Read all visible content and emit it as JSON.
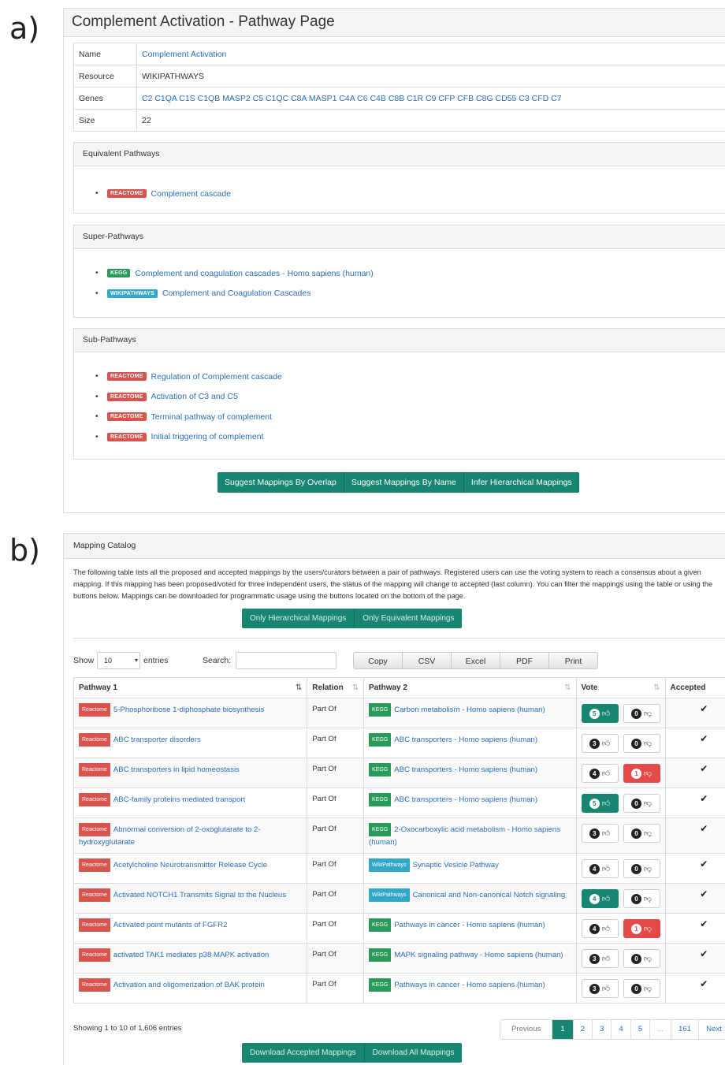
{
  "labels": {
    "a": "a)",
    "b": "b)"
  },
  "colors": {
    "accent": "#17856f",
    "reactome": "#d9534f",
    "kegg": "#2a9a5a",
    "wikipathways": "#32a8c8",
    "link": "#2a6ebb"
  },
  "pathway_page": {
    "title": "Complement Activation - Pathway Page",
    "info": [
      {
        "key": "Name",
        "value": "Complement Activation",
        "link": true
      },
      {
        "key": "Resource",
        "value": "WIKIPATHWAYS",
        "link": false
      },
      {
        "key": "Genes",
        "value": "C2 C1QA C1S C1QB MASP2 C5 C1QC C8A MASP1 C4A C6 C4B C8B C1R C9 CFP CFB C8G CD55 C3 CFD C7",
        "link": true
      },
      {
        "key": "Size",
        "value": "22",
        "link": false
      }
    ],
    "equivalent": {
      "heading": "Equivalent Pathways",
      "items": [
        {
          "badge": "REACTOME",
          "label": "Complement cascade"
        }
      ]
    },
    "super": {
      "heading": "Super-Pathways",
      "items": [
        {
          "badge": "KEGG",
          "label": "Complement and coagulation cascades - Homo sapiens (human)"
        },
        {
          "badge": "WIKIPATHWAYS",
          "label": "Complement and Coagulation Cascades"
        }
      ]
    },
    "sub": {
      "heading": "Sub-Pathways",
      "items": [
        {
          "badge": "REACTOME",
          "label": "Regulation of Complement cascade"
        },
        {
          "badge": "REACTOME",
          "label": "Activation of C3 and C5"
        },
        {
          "badge": "REACTOME",
          "label": "Terminal pathway of complement"
        },
        {
          "badge": "REACTOME",
          "label": "Initial triggering of complement"
        }
      ]
    },
    "buttons": [
      "Suggest Mappings By Overlap",
      "Suggest Mappings By Name",
      "Infer Hierarchical Mappings"
    ]
  },
  "mapping_catalog": {
    "title": "Mapping Catalog",
    "description": "The following table lists all the proposed and accepted mappings by the users/curators between a pair of pathways. Registered users can use the voting system to reach a consensus about a given mapping. If this mapping has been proposed/voted for three independent users, the status of the mapping will change to accepted (last column). You can filter the mappings using the table or using the buttons below. Mappings can be downloaded for programmatic usage using the buttons located on the bottom of the page.",
    "filter_buttons": [
      "Only Hierarchical Mappings",
      "Only Equivalent Mappings"
    ],
    "show_label": "Show",
    "entries_value": "10",
    "entries_label": "entries",
    "search_label": "Search:",
    "search_value": "",
    "export_buttons": [
      "Copy",
      "CSV",
      "Excel",
      "PDF",
      "Print"
    ],
    "columns": [
      "Pathway 1",
      "Relation",
      "Pathway 2",
      "Vote",
      "Accepted"
    ],
    "rows": [
      {
        "p1_badge": "Reactome",
        "p1": "5-Phosphoribose 1-diphosphate biosynthesis",
        "relation": "Part Of",
        "p2_badge": "KEGG",
        "p2": "Carbon metabolism - Homo sapiens (human)",
        "up": "5",
        "down": "0",
        "up_active": true,
        "down_active": false,
        "accepted": "✔"
      },
      {
        "p1_badge": "Reactome",
        "p1": "ABC transporter disorders",
        "relation": "Part Of",
        "p2_badge": "KEGG",
        "p2": "ABC transporters - Homo sapiens (human)",
        "up": "3",
        "down": "0",
        "up_active": false,
        "down_active": false,
        "accepted": "✔"
      },
      {
        "p1_badge": "Reactome",
        "p1": "ABC transporters in lipid homeostasis",
        "relation": "Part Of",
        "p2_badge": "KEGG",
        "p2": "ABC transporters - Homo sapiens (human)",
        "up": "4",
        "down": "1",
        "up_active": false,
        "down_active": true,
        "accepted": "✔"
      },
      {
        "p1_badge": "Reactome",
        "p1": "ABC-family proteins mediated transport",
        "relation": "Part Of",
        "p2_badge": "KEGG",
        "p2": "ABC transporters - Homo sapiens (human)",
        "up": "5",
        "down": "0",
        "up_active": true,
        "down_active": false,
        "accepted": "✔"
      },
      {
        "p1_badge": "Reactome",
        "p1": "Abnormal conversion of 2-oxoglutarate to 2-hydroxyglutarate",
        "relation": "Part Of",
        "p2_badge": "KEGG",
        "p2": "2-Oxocarboxylic acid metabolism - Homo sapiens (human)",
        "up": "3",
        "down": "0",
        "up_active": false,
        "down_active": false,
        "accepted": "✔"
      },
      {
        "p1_badge": "Reactome",
        "p1": "Acetylcholine Neurotransmitter Release Cycle",
        "relation": "Part Of",
        "p2_badge": "WikiPathways",
        "p2": "Synaptic Vesicle Pathway",
        "up": "4",
        "down": "0",
        "up_active": false,
        "down_active": false,
        "accepted": "✔"
      },
      {
        "p1_badge": "Reactome",
        "p1": "Activated NOTCH1 Transmits Signal to the Nucleus",
        "relation": "Part Of",
        "p2_badge": "WikiPathways",
        "p2": "Canonical and Non-canonical Notch signaling",
        "up": "4",
        "down": "0",
        "up_active": true,
        "down_active": false,
        "accepted": "✔"
      },
      {
        "p1_badge": "Reactome",
        "p1": "Activated point mutants of FGFR2",
        "relation": "Part Of",
        "p2_badge": "KEGG",
        "p2": "Pathways in cancer - Homo sapiens (human)",
        "up": "4",
        "down": "1",
        "up_active": false,
        "down_active": true,
        "accepted": "✔"
      },
      {
        "p1_badge": "Reactome",
        "p1": "activated TAK1 mediates p38 MAPK activation",
        "relation": "Part Of",
        "p2_badge": "KEGG",
        "p2": "MAPK signaling pathway - Homo sapiens (human)",
        "up": "3",
        "down": "0",
        "up_active": false,
        "down_active": false,
        "accepted": "✔"
      },
      {
        "p1_badge": "Reactome",
        "p1": "Activation and oligomerization of BAK protein",
        "relation": "Part Of",
        "p2_badge": "KEGG",
        "p2": "Pathways in cancer - Homo sapiens (human)",
        "up": "3",
        "down": "0",
        "up_active": false,
        "down_active": false,
        "accepted": "✔"
      }
    ],
    "showing": "Showing 1 to 10 of 1,606 entries",
    "pagination": [
      "Previous",
      "1",
      "2",
      "3",
      "4",
      "5",
      "...",
      "161",
      "Next"
    ],
    "download_buttons": [
      "Download Accepted Mappings",
      "Download All Mappings"
    ]
  }
}
